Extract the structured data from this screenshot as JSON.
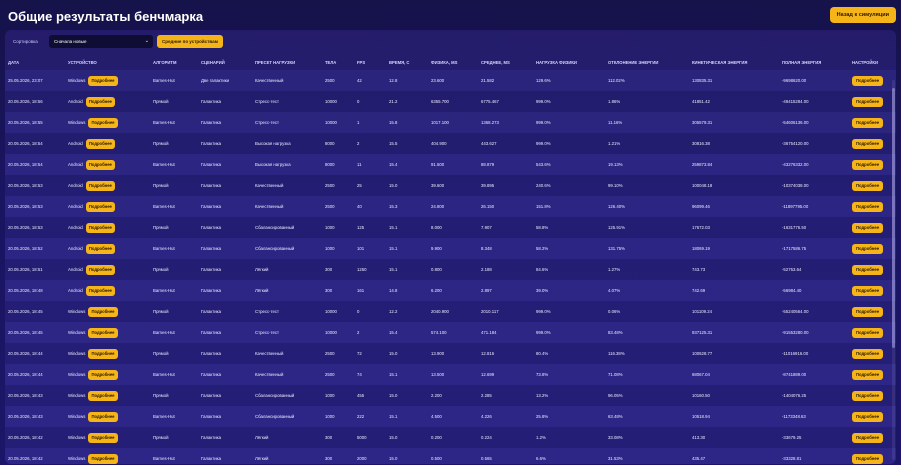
{
  "header": {
    "title": "Общие результаты бенчмарка",
    "back_label": "Назад к симуляции"
  },
  "controls": {
    "sort_label": "Сортировка",
    "sort_value": "Сначала новые",
    "avg_label": "Средние по устройствам"
  },
  "colors": {
    "accent": "#f5b418",
    "background": "#1a1560"
  },
  "table": {
    "columns": [
      "Дата",
      "Устройство",
      "Алгоритм",
      "Сценарий",
      "Пресет нагрузки",
      "Тела",
      "FPS",
      "Время, с",
      "Физика, ms",
      "Среднее, ms",
      "Нагрузка физики",
      "Отклонение энергии",
      "Кинетическая энергия",
      "Полная энергия",
      "Настройки"
    ],
    "details_label": "Подробнее",
    "rows": [
      [
        "25.05.2026, 23:07",
        "Windows",
        "Barnes-Hut",
        "Две галактики",
        "Качественный",
        "2500",
        "42",
        "12.8",
        "23.600",
        "21.582",
        "129.6%",
        "112.02%",
        "130835.31",
        "-9698620.00"
      ],
      [
        "20.05.2026, 18:56",
        "Android",
        "Прямой",
        "Галактика",
        "Стресс-тест",
        "10000",
        "0",
        "21.2",
        "6355.700",
        "6775.467",
        "999.0%",
        "1.86%",
        "41851.42",
        "-49415284.00"
      ],
      [
        "20.05.2026, 18:55",
        "Windows",
        "Barnes-Hut",
        "Галактика",
        "Стресс-тест",
        "10000",
        "1",
        "15.8",
        "1017.100",
        "1368.273",
        "999.0%",
        "11.16%",
        "305579.31",
        "-54606136.00"
      ],
      [
        "20.05.2026, 18:54",
        "Android",
        "Прямой",
        "Галактика",
        "Высокая нагрузка",
        "8000",
        "2",
        "15.5",
        "404.900",
        "443.627",
        "999.0%",
        "1.21%",
        "30816.38",
        "-36754120.00"
      ],
      [
        "20.05.2026, 18:54",
        "Android",
        "Barnes-Hut",
        "Галактика",
        "Высокая нагрузка",
        "8000",
        "11",
        "15.4",
        "91.500",
        "88.879",
        "543.6%",
        "19.13%",
        "259873.84",
        "-43276332.00"
      ],
      [
        "20.05.2026, 18:53",
        "Android",
        "Прямой",
        "Галактика",
        "Качественный",
        "2500",
        "25",
        "15.0",
        "39.600",
        "39.895",
        "240.6%",
        "99.10%",
        "100048.18",
        "-10374038.00"
      ],
      [
        "20.05.2026, 18:53",
        "Android",
        "Barnes-Hut",
        "Галактика",
        "Качественный",
        "2500",
        "40",
        "15.3",
        "24.800",
        "26.150",
        "151.8%",
        "126.40%",
        "96099.46",
        "-11897795.00"
      ],
      [
        "20.05.2026, 18:53",
        "Android",
        "Прямой",
        "Галактика",
        "Сбалансированный",
        "1000",
        "125",
        "15.1",
        "8.000",
        "7.907",
        "58.8%",
        "125.91%",
        "17672.03",
        "-1631776.50"
      ],
      [
        "20.05.2026, 18:52",
        "Android",
        "Barnes-Hut",
        "Галактика",
        "Сбалансированный",
        "1000",
        "101",
        "15.1",
        "9.900",
        "8.348",
        "58.2%",
        "131.75%",
        "18069.19",
        "-1717586.75"
      ],
      [
        "20.05.2026, 18:51",
        "Android",
        "Прямой",
        "Галактика",
        "Лёгкий",
        "300",
        "1250",
        "15.1",
        "0.800",
        "2.188",
        "84.6%",
        "1.27%",
        "743.73",
        "-52753.64"
      ],
      [
        "20.05.2026, 18:48",
        "Android",
        "Barnes-Hut",
        "Галактика",
        "Лёгкий",
        "300",
        "161",
        "14.8",
        "6.200",
        "2.897",
        "39.0%",
        "4.07%",
        "742.69",
        "-56984.40"
      ],
      [
        "20.05.2026, 18:45",
        "Windows",
        "Прямой",
        "Галактика",
        "Стресс-тест",
        "10000",
        "0",
        "12.2",
        "2040.900",
        "2010.117",
        "999.0%",
        "0.06%",
        "101109.24",
        "-55240564.00"
      ],
      [
        "20.05.2026, 18:45",
        "Windows",
        "Barnes-Hut",
        "Галактика",
        "Стресс-тест",
        "10000",
        "2",
        "15.4",
        "574.100",
        "471.184",
        "999.0%",
        "83.48%",
        "937125.31",
        "-91553280.00"
      ],
      [
        "20.05.2026, 18:44",
        "Windows",
        "Прямой",
        "Галактика",
        "Качественный",
        "2500",
        "72",
        "15.0",
        "13.900",
        "12.816",
        "80.4%",
        "116.38%",
        "100628.77",
        "-11016916.00"
      ],
      [
        "20.05.2026, 18:44",
        "Windows",
        "Barnes-Hut",
        "Галактика",
        "Качественный",
        "2500",
        "74",
        "15.1",
        "13.500",
        "12.699",
        "73.8%",
        "71.08%",
        "68067.04",
        "-8741889.00"
      ],
      [
        "20.05.2026, 18:43",
        "Windows",
        "Прямой",
        "Галактика",
        "Сбалансированный",
        "1000",
        "455",
        "15.0",
        "2.200",
        "2.285",
        "13.2%",
        "96.05%",
        "10160.50",
        "-1404076.25"
      ],
      [
        "20.05.2026, 18:43",
        "Windows",
        "Barnes-Hut",
        "Галактика",
        "Сбалансированный",
        "1000",
        "222",
        "15.1",
        "4.500",
        "4.226",
        "25.8%",
        "63.48%",
        "10518.94",
        "-1173348.63"
      ],
      [
        "20.05.2026, 18:42",
        "Windows",
        "Прямой",
        "Галактика",
        "Лёгкий",
        "300",
        "5000",
        "15.0",
        "0.200",
        "0.224",
        "1.2%",
        "33.08%",
        "413.30",
        "-33679.25"
      ],
      [
        "20.05.2026, 18:42",
        "Windows",
        "Barnes-Hut",
        "Галактика",
        "Лёгкий",
        "300",
        "2000",
        "15.0",
        "0.500",
        "0.565",
        "6.6%",
        "31.53%",
        "435.47",
        "-33328.81"
      ]
    ]
  }
}
